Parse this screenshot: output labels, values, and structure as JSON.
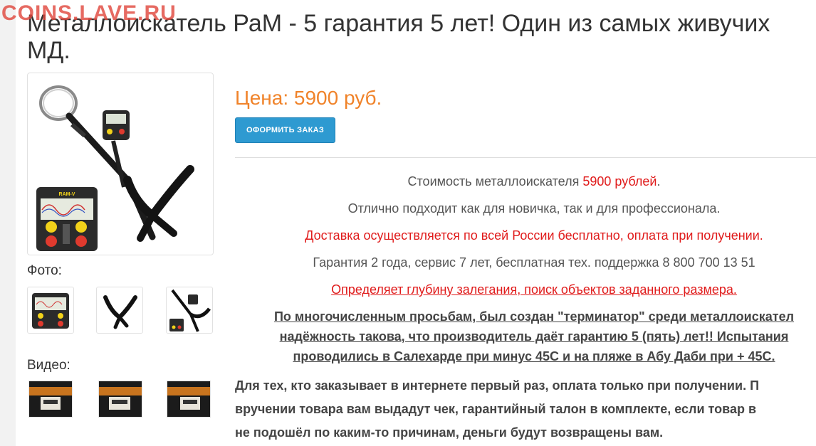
{
  "watermark": "COINS.LAVE.RU",
  "title": {
    "line1": "Металлоискатель РаМ - 5 гарантия 5 лет! Один из самых живучих",
    "line2": "МД."
  },
  "gallery": {
    "photo_label": "Фото:",
    "video_label": "Видео:"
  },
  "product": {
    "price": "Цена: 5900 руб.",
    "order_button": "ОФОРМИТЬ ЗАКАЗ"
  },
  "description": {
    "line1_before": "Стоимость металлоискателя ",
    "line1_price": "5900 рублей",
    "line1_after": ".",
    "line2": "Отлично подходит как для новичка, так и для профессионала.",
    "line3": "Доставка осуществляется по всей России бесплатно, оплата при получении.",
    "line4": "Гарантия 2 года, сервис 7 лет, бесплатная тех. поддержка 8 800 700 13 51",
    "line5": "Определяет глубину залегания, поиск объектов заданного размера.",
    "bold1": "По многочисленным просьбам, был создан \"терминатор\" среди металлоискател",
    "bold2": "надёжность такова, что производитель даёт гарантию 5 (пять) лет!! Испытания",
    "bold3": "проводились в Салехарде при минус 45С  и на пляже в Абу Даби при + 45С.",
    "para1": "Для тех, кто заказывает в интернете первый раз, оплата только при получении. П",
    "para2": "вручении товара вам выдадут чек, гарантийный талон в комплекте, если товар в",
    "para3": "не подошёл по каким-то причинам, деньги будут возвращены вам."
  },
  "device_screen": {
    "brand": "RAM-V"
  },
  "colors": {
    "price": "#f0832a",
    "button": "#2e9ad1",
    "accent_red": "#e01b1b"
  }
}
